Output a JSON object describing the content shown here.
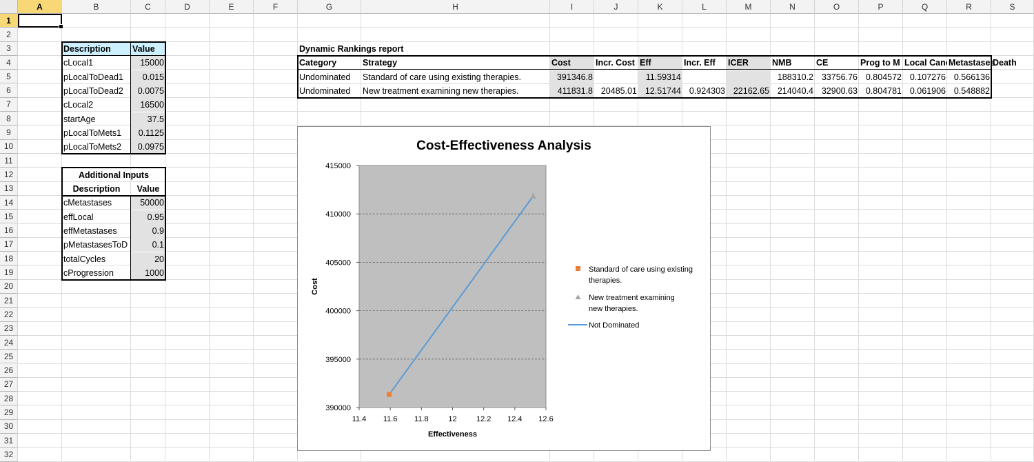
{
  "columns": [
    "A",
    "B",
    "C",
    "D",
    "E",
    "F",
    "G",
    "H",
    "I",
    "J",
    "K",
    "L",
    "M",
    "N",
    "O",
    "P",
    "Q",
    "R",
    "S"
  ],
  "rows": [
    "1",
    "2",
    "3",
    "4",
    "5",
    "6",
    "7",
    "8",
    "9",
    "10",
    "11",
    "12",
    "13",
    "14",
    "15",
    "16",
    "17",
    "18",
    "19",
    "20",
    "21",
    "22",
    "23",
    "24",
    "25",
    "26",
    "27",
    "28",
    "29",
    "30",
    "31",
    "32"
  ],
  "inputs": {
    "header": {
      "description": "Description",
      "value": "Value"
    },
    "items": [
      {
        "name": "cLocal1",
        "value": "15000"
      },
      {
        "name": "pLocalToDead1",
        "value": "0.015"
      },
      {
        "name": "pLocalToDead2",
        "value": "0.0075"
      },
      {
        "name": "cLocal2",
        "value": "16500"
      },
      {
        "name": "startAge",
        "value": "37.5"
      },
      {
        "name": "pLocalToMets1",
        "value": "0.1125"
      },
      {
        "name": "pLocalToMets2",
        "value": "0.0975"
      }
    ]
  },
  "additional": {
    "title": "Additional Inputs",
    "header": {
      "description": "Description",
      "value": "Value"
    },
    "items": [
      {
        "name": "cMetastases",
        "value": "50000"
      },
      {
        "name": "effLocal",
        "value": "0.95"
      },
      {
        "name": "effMetastases",
        "value": "0.9"
      },
      {
        "name": "pMetastasesToD",
        "value": "0.1"
      },
      {
        "name": "totalCycles",
        "value": "20"
      },
      {
        "name": "cProgression",
        "value": "1000"
      }
    ]
  },
  "rankings": {
    "title": "Dynamic Rankings report",
    "headers": [
      "Category",
      "Strategy",
      "Cost",
      "Incr. Cost",
      "Eff",
      "Incr. Eff",
      "ICER",
      "NMB",
      "CE",
      "Prog to M",
      "Local Canc",
      "Metastases",
      "Death"
    ],
    "rows": [
      [
        "Undominated",
        "Standard of care using existing therapies.",
        "391346.8",
        "",
        "11.59314",
        "",
        "",
        "188310.2",
        "33756.76",
        "0.804572",
        "0.107276",
        "0.566136",
        ""
      ],
      [
        "Undominated",
        "New treatment examining new therapies.",
        "411831.8",
        "20485.01",
        "12.51744",
        "0.924303",
        "22162.65",
        "214040.4",
        "32900.63",
        "0.804781",
        "0.061906",
        "0.548882",
        ""
      ]
    ]
  },
  "chart_data": {
    "type": "scatter",
    "title": "Cost-Effectiveness Analysis",
    "xlabel": "Effectiveness",
    "ylabel": "Cost",
    "xlim": [
      11.4,
      12.6
    ],
    "ylim": [
      390000,
      415000
    ],
    "x_ticks": [
      "11.4",
      "11.6",
      "11.8",
      "12",
      "12.2",
      "12.4",
      "12.6"
    ],
    "y_ticks": [
      "390000",
      "395000",
      "400000",
      "405000",
      "410000",
      "415000"
    ],
    "grid": "horizontal",
    "legend_position": "right",
    "series": [
      {
        "name": "Standard of care using existing therapies.",
        "marker": "square",
        "color": "#ed7d31",
        "points": [
          [
            11.59314,
            391346.8
          ]
        ]
      },
      {
        "name": "New treatment examining new therapies.",
        "marker": "triangle",
        "color": "#a5a5a5",
        "points": [
          [
            12.51744,
            411831.8
          ]
        ]
      },
      {
        "name": "Not Dominated",
        "marker": "line",
        "color": "#5b9bd5",
        "points": [
          [
            11.59314,
            391346.8
          ],
          [
            12.51744,
            411831.8
          ]
        ]
      }
    ],
    "legend": [
      "Standard of care using existing therapies.",
      "New treatment examining new therapies.",
      "Not Dominated"
    ],
    "plot_area_color": "#bfbfbf"
  }
}
